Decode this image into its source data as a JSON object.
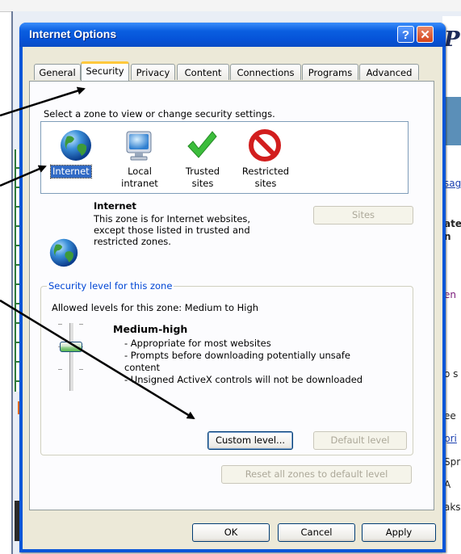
{
  "background": {
    "right_texts": [
      "sag",
      "ate",
      "n",
      "en",
      "o s",
      "ee",
      "pri",
      "Spr",
      "A",
      "aks"
    ]
  },
  "dialog": {
    "title": "Internet Options",
    "help_glyph": "?",
    "close_glyph": "✕"
  },
  "tabs": [
    "General",
    "Security",
    "Privacy",
    "Content",
    "Connections",
    "Programs",
    "Advanced"
  ],
  "active_tab": "Security",
  "security": {
    "zone_prompt": "Select a zone to view or change security settings.",
    "zones": [
      {
        "line1": "Internet",
        "line2": "",
        "icon": "globe-icon"
      },
      {
        "line1": "Local",
        "line2": "intranet",
        "icon": "monitor-icon"
      },
      {
        "line1": "Trusted",
        "line2": "sites",
        "icon": "checkmark-icon"
      },
      {
        "line1": "Restricted",
        "line2": "sites",
        "icon": "no-entry-icon"
      }
    ],
    "selected_zone": "Internet",
    "zone_title": "Internet",
    "zone_desc_1": "This zone is for Internet websites,",
    "zone_desc_2": "except those listed in trusted and",
    "zone_desc_3": "restricted zones.",
    "sites_button": "Sites",
    "group_label": "Security level for this zone",
    "allowed_levels": "Allowed levels for this zone: Medium to High",
    "level_name": "Medium-high",
    "level_lines": [
      "- Appropriate for most websites",
      "- Prompts before downloading potentially unsafe",
      "content",
      "- Unsigned ActiveX controls will not be downloaded"
    ],
    "custom_level_button": "Custom level...",
    "default_level_button": "Default level",
    "reset_all_button": "Reset all zones to default level"
  },
  "footer": {
    "ok": "OK",
    "cancel": "Cancel",
    "apply": "Apply"
  }
}
